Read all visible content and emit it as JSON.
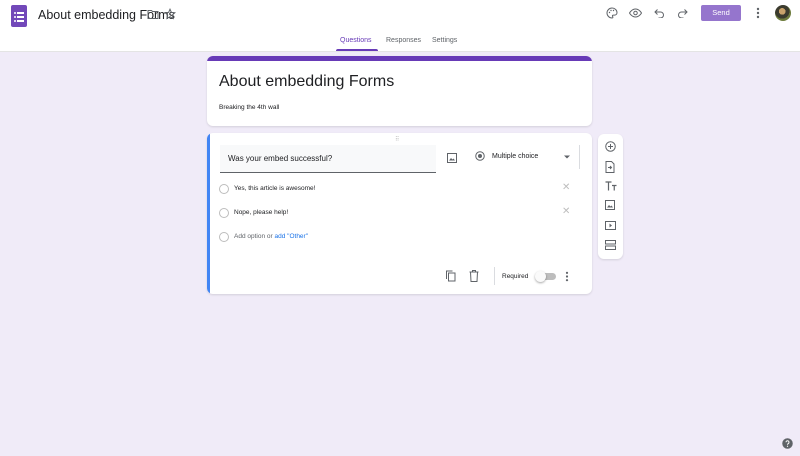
{
  "header": {
    "title": "About embedding Forms",
    "icons": [
      "folder-icon",
      "star-icon",
      "palette-icon",
      "preview-eye-icon",
      "undo-icon",
      "redo-icon",
      "more-vert-icon"
    ],
    "send_label": "Send"
  },
  "tabs": [
    {
      "label": "Questions",
      "active": true
    },
    {
      "label": "Responses",
      "active": false
    },
    {
      "label": "Settings",
      "active": false
    }
  ],
  "form": {
    "title": "About embedding Forms",
    "description": "Breaking the 4th wall"
  },
  "question": {
    "text": "Was your embed successful?",
    "type": "Multiple choice",
    "options": [
      {
        "label": "Yes, this article is awesome!"
      },
      {
        "label": "Nope, please help!"
      }
    ],
    "add_option_label": "Add option",
    "add_other_connector": "or",
    "add_other_label": "add \"Other\"",
    "required_label": "Required",
    "required": false
  },
  "side_toolbar": [
    "add-question-icon",
    "import-questions-icon",
    "add-title-icon",
    "add-image-icon",
    "add-video-icon",
    "add-section-icon"
  ],
  "colors": {
    "accent": "#673ab7",
    "background": "#f0ebf8",
    "send_button": "#9575cd",
    "active_question": "#4285f4"
  }
}
